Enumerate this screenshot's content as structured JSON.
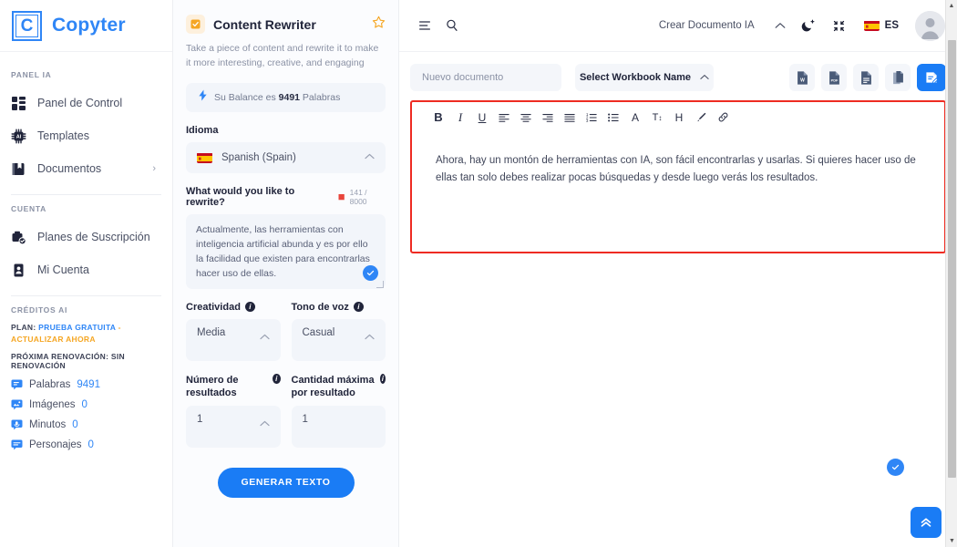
{
  "brand": {
    "mark": "C",
    "name": "Copyter"
  },
  "sidebar": {
    "sections": [
      {
        "title": "PANEL IA",
        "items": [
          {
            "label": "Panel de Control",
            "icon": "dashboard-icon",
            "chevron": ""
          },
          {
            "label": "Templates",
            "icon": "ai-chip-icon",
            "chevron": ""
          },
          {
            "label": "Documentos",
            "icon": "documents-icon",
            "chevron": "›"
          }
        ]
      },
      {
        "title": "CUENTA",
        "items": [
          {
            "label": "Planes de Suscripción",
            "icon": "subscription-icon",
            "chevron": ""
          },
          {
            "label": "Mi Cuenta",
            "icon": "account-icon",
            "chevron": ""
          }
        ]
      }
    ],
    "credits": {
      "title": "CRÉDITOS AI",
      "plan_key": "PLAN:",
      "plan_value": "PRUEBA GRATUITA",
      "plan_sep": "-",
      "plan_upgrade": "ACTUALIZAR AHORA",
      "renewal": "PRÓXIMA RENOVACIÓN: SIN RENOVACIÓN",
      "rows": [
        {
          "name": "Palabras",
          "value": "9491"
        },
        {
          "name": "Imágenes",
          "value": "0"
        },
        {
          "name": "Minutos",
          "value": "0"
        },
        {
          "name": "Personajes",
          "value": "0"
        }
      ]
    }
  },
  "topbar": {
    "menu_icon": "menu-lines-icon",
    "search_icon": "search-icon",
    "create_doc_label": "Crear Documento IA",
    "create_doc_caret": "⌃",
    "dark_mode_icon": "moon-icon",
    "fullscreen_icon": "compress-icon",
    "language_code": "ES",
    "language_flag": "spain-flag-icon",
    "avatar_icon": "user-avatar-icon"
  },
  "form": {
    "tool_title": "Content Rewriter",
    "tool_badge_icon": "rewrite-icon",
    "favorite_icon": "star-icon",
    "description": "Take a piece of content and rewrite it to make it more interesting, creative, and engaging",
    "balance_prefix": "Su Balance es",
    "balance_value": "9491",
    "balance_suffix": "Palabras",
    "balance_icon": "lightning-icon",
    "language_label": "Idioma",
    "language_value": "Spanish (Spain)",
    "rewrite_label": "What would you like to rewrite?",
    "rewrite_counter": "141 / 8000",
    "rewrite_text": "Actualmente, las herramientas con inteligencia artificial abunda y es por ello la facilidad que existen para encontrarlas hacer uso de ellas.",
    "creativity_label": "Creatividad",
    "creativity_value": "Media",
    "tone_label": "Tono de voz",
    "tone_value": "Casual",
    "results_label": "Número de resultados",
    "results_value": "1",
    "max_label": "Cantidad máxima por resultado",
    "max_value": "1",
    "generate_button": "GENERAR TEXTO"
  },
  "editor": {
    "doc_name_placeholder": "Nuevo documento",
    "workbook_label": "Select Workbook Name",
    "workbook_caret": "⌃",
    "export_buttons": [
      {
        "name": "export-word-button",
        "label": "W"
      },
      {
        "name": "export-pdf-button",
        "label": "PDF"
      },
      {
        "name": "export-text-button",
        "label": ""
      },
      {
        "name": "copy-document-button",
        "label": ""
      }
    ],
    "save_button_icon": "save-document-icon",
    "toolbar": [
      {
        "name": "bold-button",
        "glyph": "B"
      },
      {
        "name": "italic-button",
        "glyph": "I"
      },
      {
        "name": "underline-button",
        "glyph": "U"
      },
      {
        "name": "align-left-button",
        "glyph": ""
      },
      {
        "name": "align-center-button",
        "glyph": ""
      },
      {
        "name": "align-right-button",
        "glyph": ""
      },
      {
        "name": "align-justify-button",
        "glyph": ""
      },
      {
        "name": "ordered-list-button",
        "glyph": ""
      },
      {
        "name": "unordered-list-button",
        "glyph": ""
      },
      {
        "name": "font-color-button",
        "glyph": "A"
      },
      {
        "name": "font-size-button",
        "glyph": "T"
      },
      {
        "name": "heading-button",
        "glyph": "H"
      },
      {
        "name": "highlight-brush-button",
        "glyph": ""
      },
      {
        "name": "insert-link-button",
        "glyph": ""
      }
    ],
    "content": "Ahora, hay un montón de herramientas con IA, son fácil encontrarlas y usarlas. Si quieres hacer uso de ellas tan solo debes realizar pocas búsquedas y desde luego verás los resultados."
  },
  "floating": {
    "check_icon": "check-circle-icon",
    "scroll_top_icon": "double-chevron-up-icon"
  },
  "colors": {
    "accent_blue": "#1a7cf5",
    "brand_blue": "#2f86f6",
    "highlight_red": "#ee2b22",
    "orange": "#f5a623"
  }
}
